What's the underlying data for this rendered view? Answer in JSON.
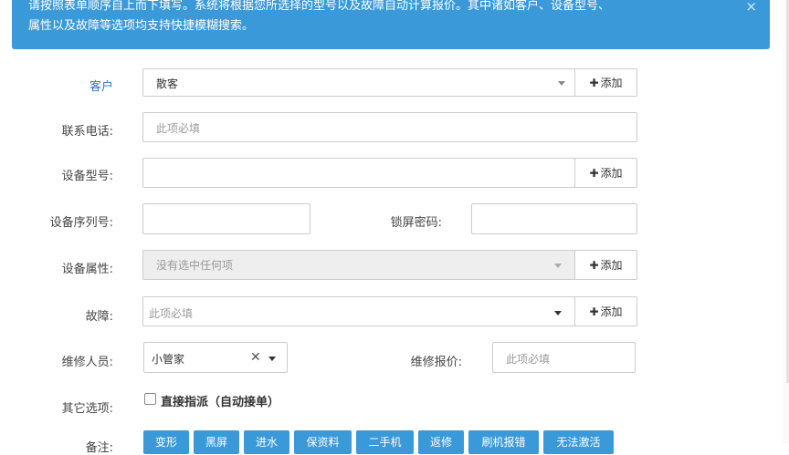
{
  "notice": {
    "line1": "请按照表单顺序自上而下填写。系统将根据您所选择的型号以及故障自动计算报价。其中诸如客户、设备型号、",
    "line2": "属性以及故障等选项均支持快捷模糊搜索。",
    "close": "×"
  },
  "add_label": "添加",
  "add_plus": "✚",
  "fields": {
    "customer": {
      "label": "客户",
      "value": "散客"
    },
    "phone": {
      "label": "联系电话:",
      "placeholder": "此项必填"
    },
    "model": {
      "label": "设备型号:",
      "value": ""
    },
    "serial": {
      "label": "设备序列号:",
      "value": ""
    },
    "lock": {
      "label": "锁屏密码:",
      "value": ""
    },
    "attributes": {
      "label": "设备属性:",
      "placeholder": "没有选中任何项"
    },
    "fault": {
      "label": "故障:",
      "placeholder": "此项必填"
    },
    "tech": {
      "label": "维修人员:",
      "value": "小管家",
      "clear": "✕"
    },
    "price": {
      "label": "维修报价:",
      "placeholder": "此项必填"
    },
    "other": {
      "label": "其它选项:",
      "checkbox_label": "直接指派（自动接单）"
    },
    "notes": {
      "label": "备注:"
    }
  },
  "note_tags": [
    "变形",
    "黑屏",
    "进水",
    "保资料",
    "二手机",
    "返修",
    "刷机报错",
    "无法激活"
  ],
  "colors": {
    "accent": "#3a9ad9",
    "label_link": "#2a76c6"
  }
}
